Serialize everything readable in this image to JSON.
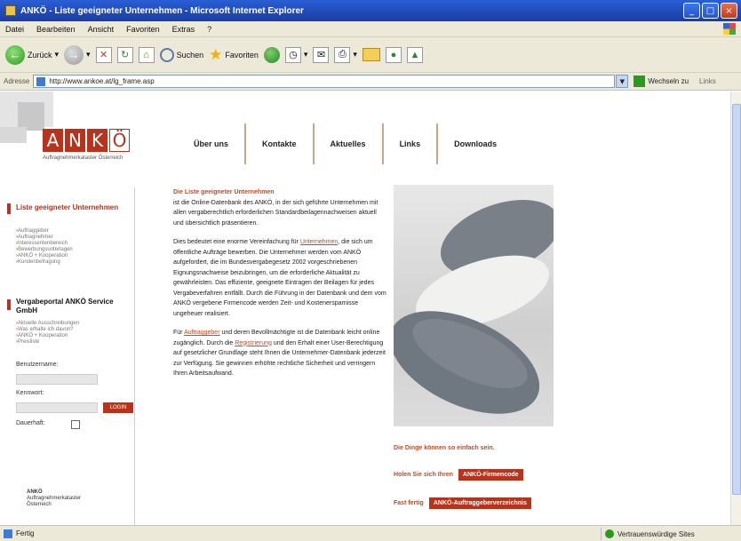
{
  "window": {
    "title": "ANKÖ - Liste geeigneter Unternehmen - Microsoft Internet Explorer",
    "controls": [
      "_",
      "□",
      "×"
    ]
  },
  "menu": [
    "Datei",
    "Bearbeiten",
    "Ansicht",
    "Favoriten",
    "Extras",
    "?"
  ],
  "toolbar": {
    "back": "Zurück",
    "search": "Suchen",
    "favorites": "Favoriten"
  },
  "address": {
    "label": "Adresse",
    "url": "http://www.ankoe.at/lg_frame.asp",
    "go": "Wechseln zu",
    "links": "Links"
  },
  "site": {
    "logo_letters": [
      "A",
      "N",
      "K",
      "Ö"
    ],
    "logo_sub": "Auftragnehmerkataster Österreich",
    "nav": [
      "Über uns",
      "Kontakte",
      "Aktuelles",
      "Links",
      "Downloads"
    ]
  },
  "sidebar": {
    "head1": "Liste geeigneter Unternehmen",
    "list1": [
      "Auftraggeber",
      "Auftragnehmer",
      "Interessentenbereich",
      "Bewerbungsunterlagen",
      "ANKÖ + Kooperation",
      "Kundenbefragung"
    ],
    "head2": "Vergabeportal ANKÖ Service GmbH",
    "list2": [
      "Aktuelle Ausschreibungen",
      "Was erhalte ich davon?",
      "ANKÖ + Kooperation",
      "Preisliste"
    ],
    "username_label": "Benutzername:",
    "password_label": "Kennwort:",
    "login": "LOGIN",
    "persist_label": "Dauerhaft:",
    "footer": [
      "ANKÖ",
      "Auftragnehmerkataster",
      "Österreich"
    ]
  },
  "main": {
    "intro_head": "Die Liste geeigneter Unternehmen",
    "p1": "ist die Online-Datenbank des ANKÖ, in der sich geführte Unternehmen mit allen vergaberechtlich erforderlichen Standardbeilagennachweisen aktuell und übersichtlich präsentieren.",
    "p2_a": "Dies bedeutet eine enorme Vereinfachung für",
    "p2_link": "Unternehmen",
    "p2_b": ", die sich um öffentliche Aufträge bewerben. Die Unternehmer werden vom ANKÖ aufgefordert, die im Bundesvergabegesetz 2002 vorgeschriebenen Eignungsnachweise beizubringen, um die erforderliche Aktualität zu gewährleisten. Das effiziente, geeignete Eintragen der Beilagen für jedes Vergabeverfahren entfällt. Durch die Führung in der Datenbank und dem vom ANKÖ vergebene Firmencode werden Zeit- und Kostenersparnisse ungeheuer realisiert.",
    "p3_a": "Für",
    "p3_link1": "Auftraggeber",
    "p3_b": "und deren Bevollmächtigte ist die Datenbank leicht online zugänglich. Durch die",
    "p3_link2": "Registrierung",
    "p3_c": "und den Erhalt einer User-Berechtigung auf gesetzlicher Grundlage steht Ihnen die Unternehmer-Datenbank jederzeit zur Verfügung. Sie gewinnen erhöhte rechtliche Sicherheit und verringern Ihren Arbeitsaufwand."
  },
  "cta": {
    "tagline": "Die Dinge können so einfach sein.",
    "row1_text": "Holen Sie sich Ihren",
    "row1_btn": "ANKÖ-Firmencode",
    "row2_text": "Fast fertig",
    "row2_btn": "ANKÖ-Auftraggeberverzeichnis"
  },
  "status": {
    "text": "Fertig",
    "zone": "Vertrauenswürdige Sites"
  }
}
